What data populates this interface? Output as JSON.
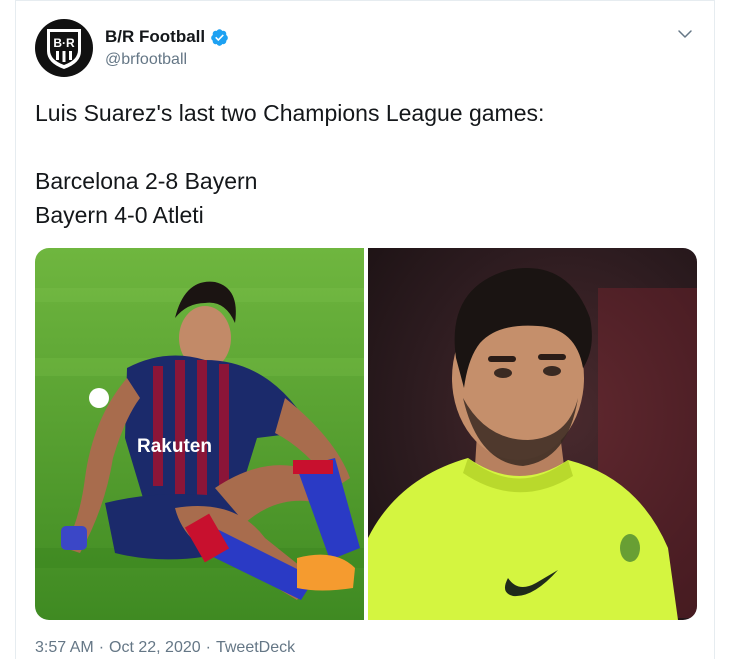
{
  "account": {
    "display_name": "B/R Football",
    "handle": "@brfootball",
    "verified": true,
    "avatar_icon": "br-logo-icon",
    "avatar_monogram": "B·R"
  },
  "tweet": {
    "lines": [
      "Luis Suarez's last two Champions League games:",
      "",
      "Barcelona 2-8 Bayern",
      "Bayern 4-0 Atleti"
    ]
  },
  "media": {
    "photos": [
      {
        "name": "photo-barcelona-kit",
        "jersey_text": "Rakuten"
      },
      {
        "name": "photo-atletico-kit"
      }
    ]
  },
  "meta": {
    "time": "3:57 AM",
    "date": "Oct 22, 2020",
    "source": "TweetDeck",
    "separator": "·"
  },
  "colors": {
    "verified": "#1da1f2",
    "secondary_text": "#657786",
    "pitch": "#4e9a2a",
    "atletico_bg": "#2b1a1d",
    "atletico_shirt": "#d4f540"
  }
}
